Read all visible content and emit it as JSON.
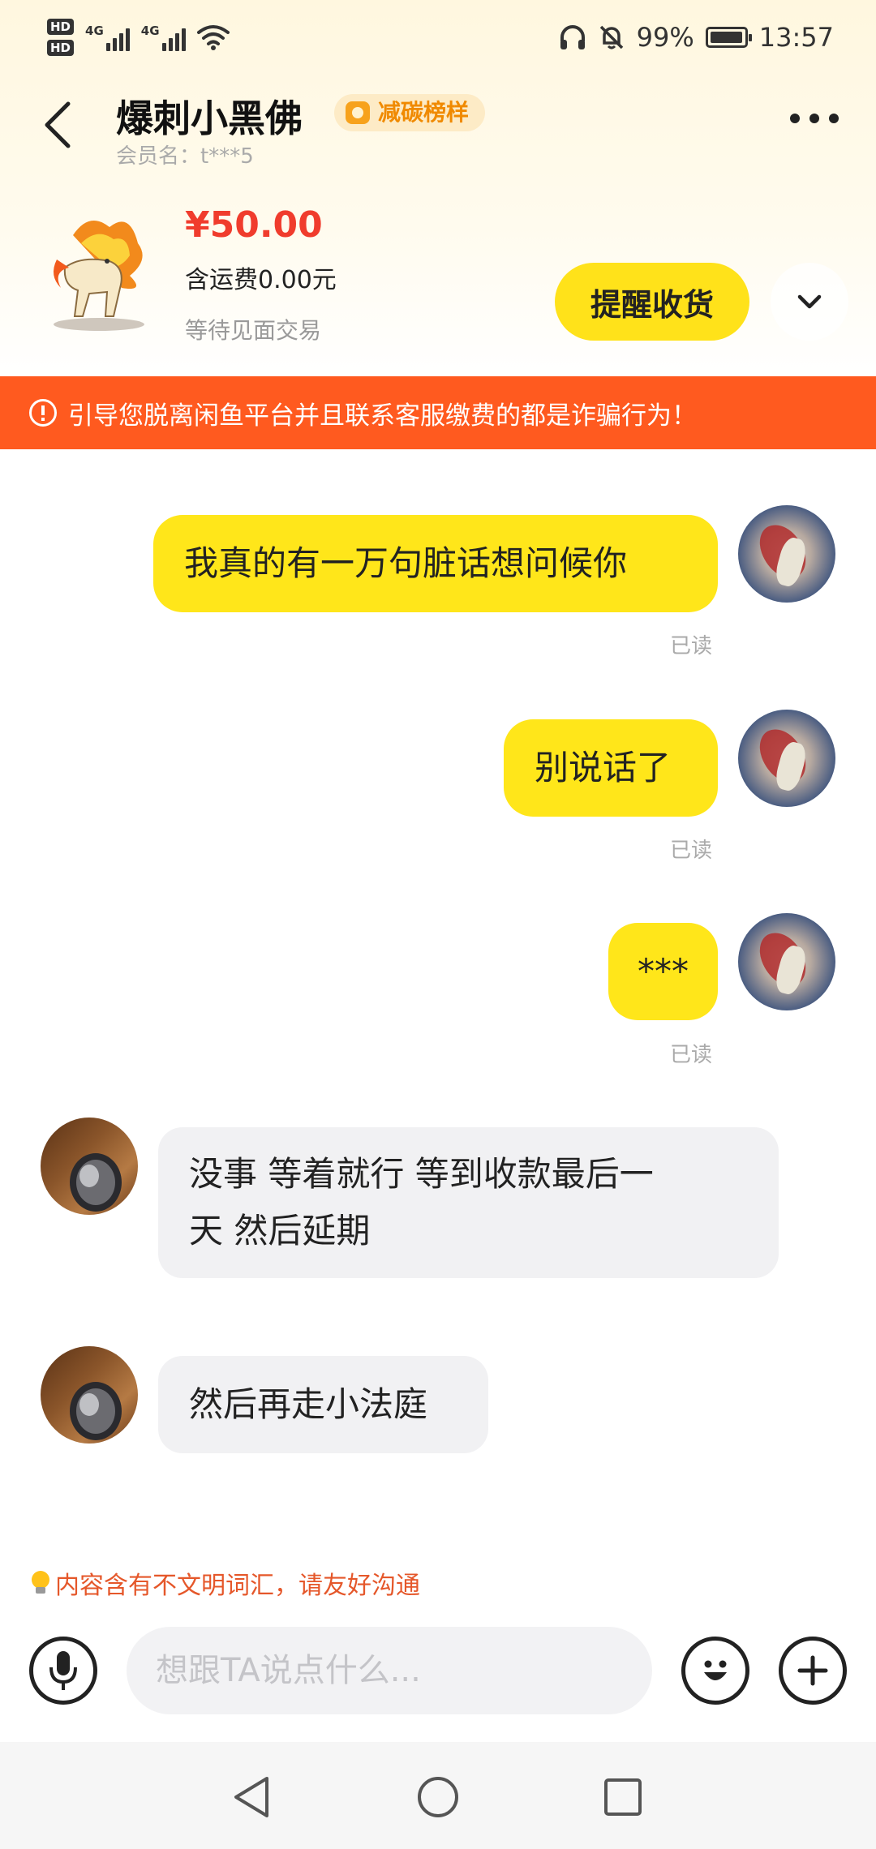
{
  "status_bar": {
    "hd1": "HD",
    "hd2": "HD",
    "sim1": "4G",
    "sim2": "4G",
    "battery": "99%",
    "time": "13:57"
  },
  "header": {
    "title": "爆刺小黑佛",
    "badge": "减碳榜样",
    "member": "会员名：t***5"
  },
  "item": {
    "price": "¥50.00",
    "shipping": "含运费0.00元",
    "status": "等待见面交易",
    "remind_label": "提醒收货"
  },
  "warning": "引导您脱离闲鱼平台并且联系客服缴费的都是诈骗行为！",
  "messages": [
    {
      "side": "self",
      "text": "我真的有一万句脏话想问候你",
      "status": "已读"
    },
    {
      "side": "self",
      "text": "别说话了",
      "status": "已读"
    },
    {
      "side": "self",
      "text": "***",
      "status": "已读"
    },
    {
      "side": "other",
      "line1": "没事 等着就行 等到收款最后一",
      "line2": "天 然后延期"
    },
    {
      "side": "other",
      "text": "然后再走小法庭"
    }
  ],
  "civility_notice": "内容含有不文明词汇，请友好沟通",
  "input": {
    "placeholder": "想跟TA说点什么..."
  },
  "colors": {
    "accent_yellow": "#ffe61a",
    "warning_orange": "#ff5a1f",
    "price_red": "#f03c2d"
  }
}
